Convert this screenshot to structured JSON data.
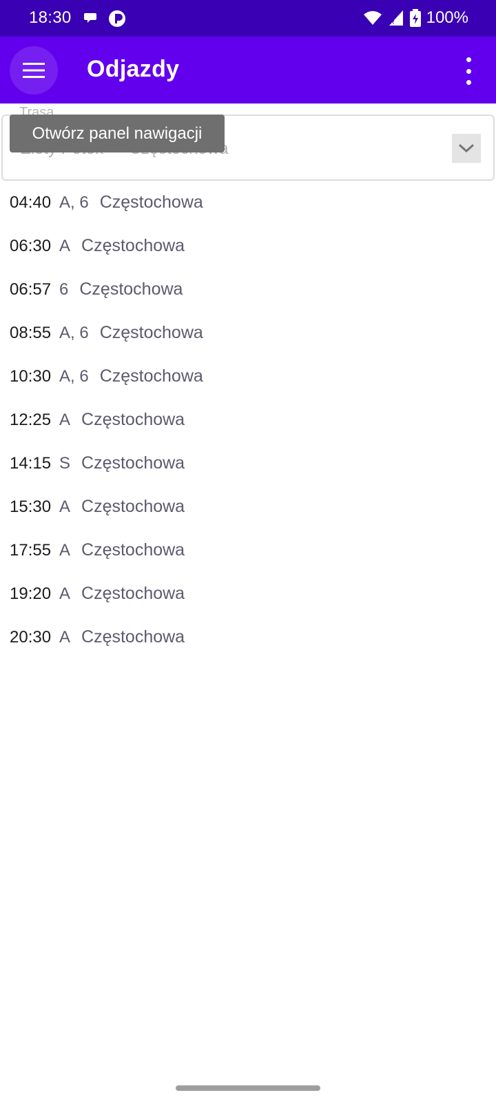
{
  "status_bar": {
    "time": "18:30",
    "icons": [
      "chat-bubble-icon",
      "pinwheel-app-icon",
      "wifi-icon",
      "signal-icon",
      "battery-charging-icon"
    ],
    "battery": "100%"
  },
  "app_bar": {
    "title": "Odjazdy",
    "menu_icon": "hamburger-menu-icon",
    "overflow_icon": "more-vert-icon"
  },
  "route": {
    "label": "Trasa",
    "value": "Złoty Potok — Częstochowa"
  },
  "tooltip": {
    "text": "Otwórz panel nawigacji"
  },
  "departures": [
    {
      "time": "04:40",
      "lines": "A, 6",
      "destination": "Częstochowa"
    },
    {
      "time": "06:30",
      "lines": "A",
      "destination": "Częstochowa"
    },
    {
      "time": "06:57",
      "lines": "6",
      "destination": "Częstochowa"
    },
    {
      "time": "08:55",
      "lines": "A, 6",
      "destination": "Częstochowa"
    },
    {
      "time": "10:30",
      "lines": "A, 6",
      "destination": "Częstochowa"
    },
    {
      "time": "12:25",
      "lines": "A",
      "destination": "Częstochowa"
    },
    {
      "time": "14:15",
      "lines": "S",
      "destination": "Częstochowa"
    },
    {
      "time": "15:30",
      "lines": "A",
      "destination": "Częstochowa"
    },
    {
      "time": "17:55",
      "lines": "A",
      "destination": "Częstochowa"
    },
    {
      "time": "19:20",
      "lines": "A",
      "destination": "Częstochowa"
    },
    {
      "time": "20:30",
      "lines": "A",
      "destination": "Częstochowa"
    }
  ],
  "colors": {
    "status_bar": "#3a00b3",
    "app_bar": "#6200ee",
    "text_secondary": "#5e5a6e"
  }
}
